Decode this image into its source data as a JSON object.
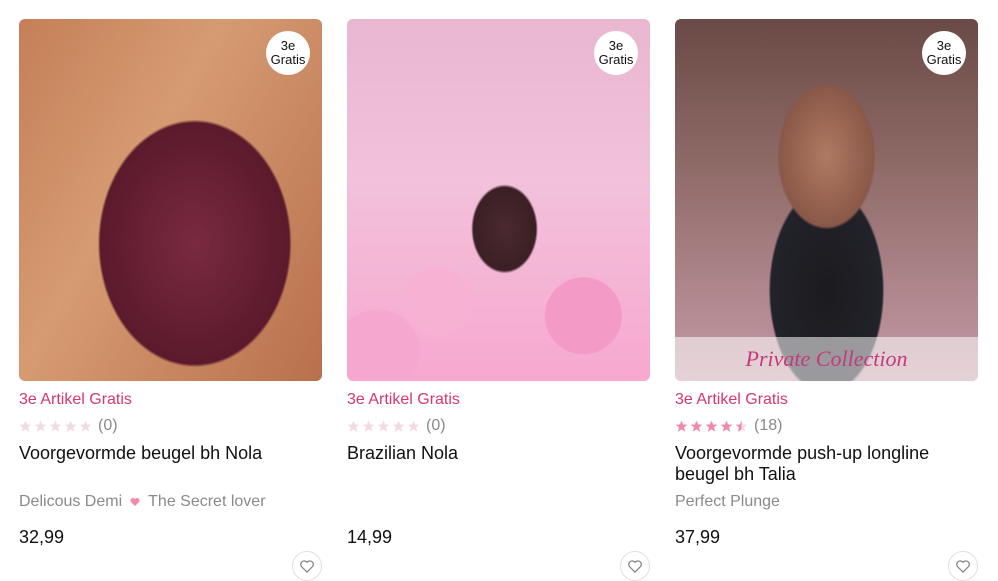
{
  "products": [
    {
      "badge": {
        "line1": "3e",
        "line2": "Gratis"
      },
      "promo": "3e Artikel Gratis",
      "rating": {
        "stars": 0,
        "count": "(0)"
      },
      "name": "Voorgevormde beugel bh Nola",
      "collections": [
        "Delicous Demi",
        "The Secret lover"
      ],
      "price": "32,99"
    },
    {
      "badge": {
        "line1": "3e",
        "line2": "Gratis"
      },
      "promo": "3e Artikel Gratis",
      "rating": {
        "stars": 0,
        "count": "(0)"
      },
      "name": "Brazilian Nola",
      "collections": [],
      "price": "14,99"
    },
    {
      "badge": {
        "line1": "3e",
        "line2": "Gratis"
      },
      "image_caption": "Private Collection",
      "promo": "3e Artikel Gratis",
      "rating": {
        "stars": 4.5,
        "count": "(18)"
      },
      "name": "Voorgevormde push-up longline beugel bh Talia",
      "collections": [
        "Perfect Plunge"
      ],
      "price": "37,99"
    }
  ],
  "colors": {
    "promo": "#d6376f",
    "star_filled": "#f08aa8",
    "star_empty": "#f3dbe2",
    "muted": "#8a8a8a"
  },
  "icons": {
    "star": "star-icon",
    "heart": "heart-icon",
    "wishlist": "wishlist-heart-icon"
  }
}
